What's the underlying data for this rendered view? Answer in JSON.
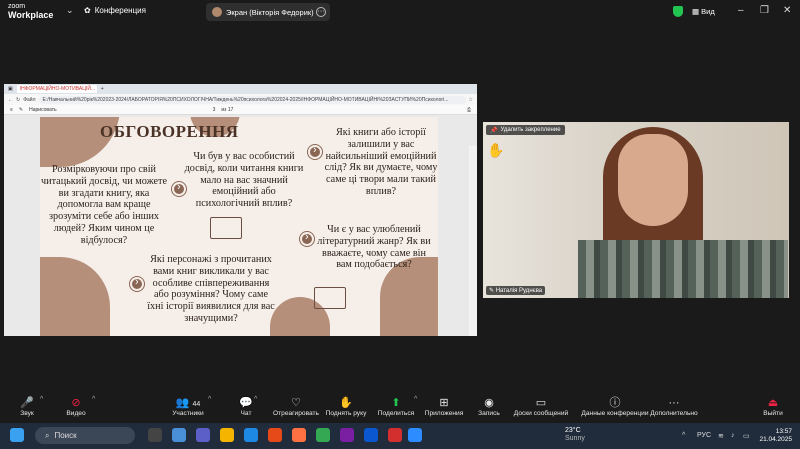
{
  "top": {
    "logo_line1": "zoom",
    "logo_line2": "Workplace",
    "conference_label": "Конференция",
    "screen_label": "Экран (Вікторія Федорик)",
    "view_label": "Вид"
  },
  "browser": {
    "tab_title": "ІНФОРМАЦІЙНО-МОТИВАЦІЙ...",
    "file_label": "Файл",
    "url": "E:/Навчальний%20рік%202023-2024/ЛАБОРАТОРІЯ%20ПСИХОЛОГІЧНА/Тиждень%20психолога%202024-2025/ІНФОРМАЦІЙНО-МОТИВАЦІЙНІ%20ЗАСТУПИ%20Психологі...",
    "toolbar_draw": "Нарисовать",
    "page_num": "3",
    "page_of": "из 17"
  },
  "slide": {
    "title": "ОБГОВОРЕННЯ",
    "q1": "Розмірковуючи про свій читацький досвід, чи можете ви згадати книгу, яка допомогла вам краще зрозуміти себе або інших людей? Яким чином це відбулося?",
    "q2": "Чи був у вас особистий досвід, коли читання книги мало на вас значний емоційний або психологічний вплив?",
    "q3": "Які книги або історії залишили у вас найсильніший емоційний слід? Як ви думаєте, чому саме ці твори мали такий вплив?",
    "q4": "Чи є у вас улюблений літературний жанр? Як ви вважаєте, чому саме він вам подобається?",
    "q5": "Які персонажі з прочитаних вами книг викликали у вас особливе співпереживання або розуміння? Чому саме їхні історії виявилися для вас значущими?"
  },
  "video": {
    "unpin_label": "Удалить закрепление",
    "participant_name": "Наталія Руднєва"
  },
  "toolbar": {
    "audio": "Звук",
    "video": "Видео",
    "participants": "Участники",
    "participants_count": "44",
    "chat": "Чат",
    "react": "Отреагировать",
    "raise_hand": "Поднять руку",
    "share": "Поделиться",
    "apps": "Приложения",
    "record": "Запись",
    "whiteboards": "Доски сообщений",
    "conf_data": "Данные конференции",
    "more": "Дополнительно",
    "leave": "Выйти"
  },
  "taskbar": {
    "search": "Поиск",
    "weather_temp": "23°C",
    "weather_desc": "Sunny",
    "lang": "РУС",
    "time": "13:57",
    "date": "21.04.2025"
  }
}
